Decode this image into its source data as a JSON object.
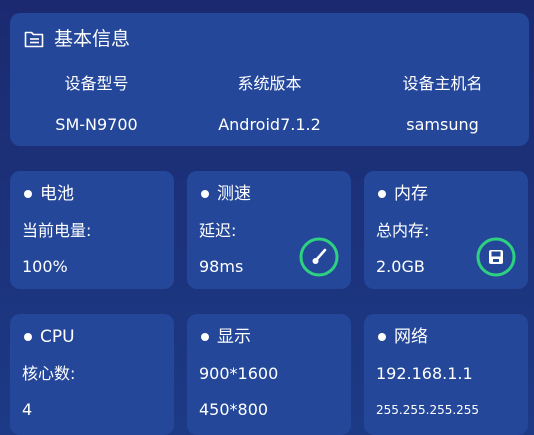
{
  "info": {
    "title": "基本信息",
    "icon": "folder-icon",
    "labels": [
      "设备型号",
      "系统版本",
      "设备主机名"
    ],
    "values": [
      "SM-N9700",
      "Android7.1.2",
      "samsung"
    ]
  },
  "battery": {
    "title": "电池",
    "label": "当前电量:",
    "value": "100%"
  },
  "speed": {
    "title": "测速",
    "label": "延迟:",
    "value": "98ms",
    "icon": "speedometer-icon"
  },
  "memory": {
    "title": "内存",
    "label": "总内存:",
    "value": "2.0GB",
    "icon": "save-icon"
  },
  "cpu": {
    "title": "CPU",
    "label": "核心数:",
    "value": "4"
  },
  "display": {
    "title": "显示",
    "resolution1": "900*1600",
    "resolution2": "450*800"
  },
  "network": {
    "title": "网络",
    "ip": "192.168.1.1",
    "mask": "255.255.255.255"
  },
  "colors": {
    "background": "#1b2a70",
    "card": "#24479a",
    "accent_green": "#2ed17f",
    "text": "#ffffff"
  }
}
